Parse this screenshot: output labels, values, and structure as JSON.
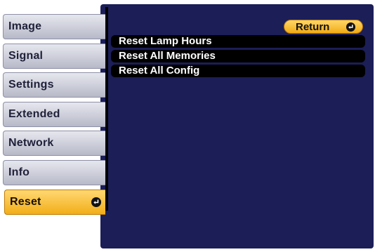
{
  "sidebar": {
    "items": [
      {
        "label": "Image"
      },
      {
        "label": "Signal"
      },
      {
        "label": "Settings"
      },
      {
        "label": "Extended"
      },
      {
        "label": "Network"
      },
      {
        "label": "Info"
      },
      {
        "label": "Reset",
        "selected": true
      }
    ]
  },
  "main": {
    "return_label": "Return",
    "items": [
      {
        "label": "Reset Lamp Hours"
      },
      {
        "label": "Reset All Memories"
      },
      {
        "label": "Reset All Config"
      }
    ]
  },
  "colors": {
    "panel_bg": "#1b1e57",
    "selected_accent": "#f2ae18",
    "tab_bg": "#c9cbd6",
    "item_bg": "#000000"
  },
  "icons": {
    "enter": "enter-icon"
  }
}
